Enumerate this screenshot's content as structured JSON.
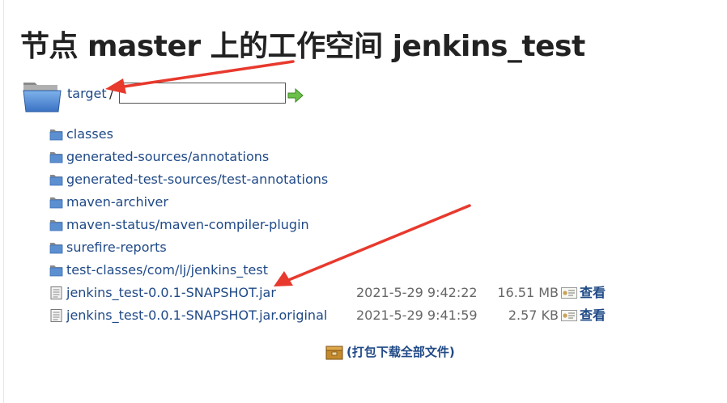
{
  "page": {
    "title": "节点 master 上的工作空间 jenkins_test"
  },
  "breadcrumb": {
    "folder_label": "target",
    "separator": "/",
    "path_input_value": ""
  },
  "entries": [
    {
      "type": "folder",
      "name": "classes"
    },
    {
      "type": "folder",
      "name": "generated-sources/annotations"
    },
    {
      "type": "folder",
      "name": "generated-test-sources/test-annotations"
    },
    {
      "type": "folder",
      "name": "maven-archiver"
    },
    {
      "type": "folder",
      "name": "maven-status/maven-compiler-plugin"
    },
    {
      "type": "folder",
      "name": "surefire-reports"
    },
    {
      "type": "folder",
      "name": "test-classes/com/lj/jenkins_test"
    },
    {
      "type": "file",
      "name": "jenkins_test-0.0.1-SNAPSHOT.jar",
      "date": "2021-5-29 9:42:22",
      "size": "16.51 MB",
      "view": "查看"
    },
    {
      "type": "file",
      "name": "jenkins_test-0.0.1-SNAPSHOT.jar.original",
      "date": "2021-5-29 9:41:59",
      "size": "2.57 KB",
      "view": "查看"
    }
  ],
  "download_all": {
    "label": "(打包下载全部文件)"
  },
  "icons": {
    "folder": "folder-icon",
    "file": "file-icon",
    "go": "go-arrow-icon",
    "view": "view-fingerprint-icon",
    "zip": "zip-archive-icon"
  },
  "colors": {
    "link": "#204a87",
    "annotation_arrow": "#e8392d",
    "folder_blue": "#5b8fd0"
  }
}
